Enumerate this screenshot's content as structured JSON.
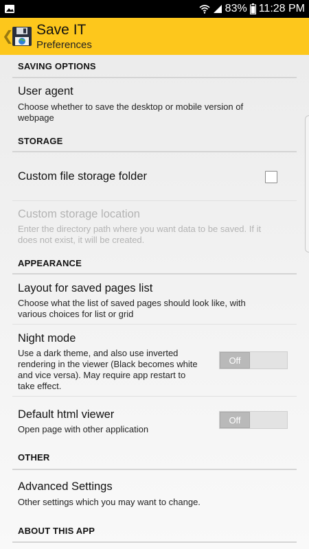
{
  "status_bar": {
    "battery": "83%",
    "time": "11:28 PM"
  },
  "app_bar": {
    "title": "Save IT",
    "subtitle": "Preferences"
  },
  "sections": {
    "saving": {
      "header": "SAVING OPTIONS",
      "user_agent_title": "User agent",
      "user_agent_summary_1": "Choose whether to save the desktop or mobile version of",
      "user_agent_summary_2": "webpage"
    },
    "storage": {
      "header": "STORAGE",
      "custom_folder_title": "Custom file storage folder",
      "custom_folder_checked": false,
      "location_title": "Custom storage location",
      "location_summary_1": "Enter the directory path where you want data to be saved. If it",
      "location_summary_2": "does not exist, it will be created."
    },
    "appearance": {
      "header": "APPEARANCE",
      "layout_title": "Layout for saved pages list",
      "layout_summary_1": "Choose what the list of saved pages should look like, with",
      "layout_summary_2": "various choices for list or grid",
      "night_title": "Night mode",
      "night_summary_1": "Use a dark theme, and also use inverted",
      "night_summary_2": "rendering in the viewer (Black becomes white",
      "night_summary_3": "and vice versa). May require app restart to",
      "night_summary_4": "take effect.",
      "night_toggle": "Off",
      "viewer_title": "Default html viewer",
      "viewer_summary": "Open page with other application",
      "viewer_toggle": "Off"
    },
    "other": {
      "header": "OTHER",
      "advanced_title": "Advanced Settings",
      "advanced_summary": "Other settings which you may want to change."
    },
    "about": {
      "header": "ABOUT THIS APP"
    }
  },
  "colors": {
    "app_bar": "#fdc71c",
    "status_bar": "#000000"
  }
}
